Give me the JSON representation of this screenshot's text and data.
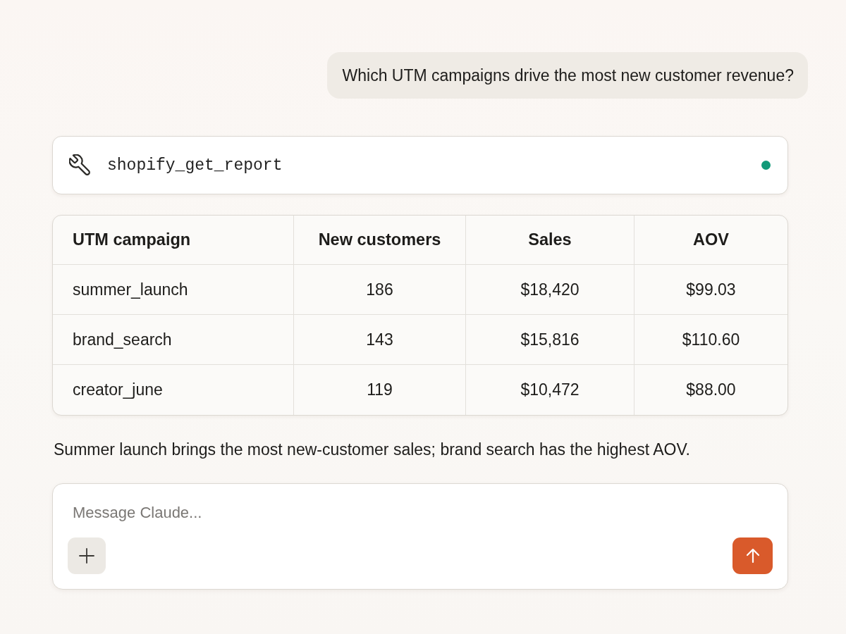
{
  "user_message": "Which UTM campaigns drive the most new customer revenue?",
  "tool_call": {
    "name": "shopify_get_report",
    "done": true
  },
  "table": {
    "columns": [
      "UTM campaign",
      "New customers",
      "Sales",
      "AOV"
    ],
    "rows": [
      [
        "summer_launch",
        "186",
        "$18,420",
        "$99.03"
      ],
      [
        "brand_search",
        "143",
        "$15,816",
        "$110.60"
      ],
      [
        "creator_june",
        "119",
        "$10,472",
        "$88.00"
      ]
    ]
  },
  "reply": "Summer launch brings the most new-customer sales; brand search has the highest AOV.",
  "composer": {
    "placeholder": "Message Claude..."
  }
}
